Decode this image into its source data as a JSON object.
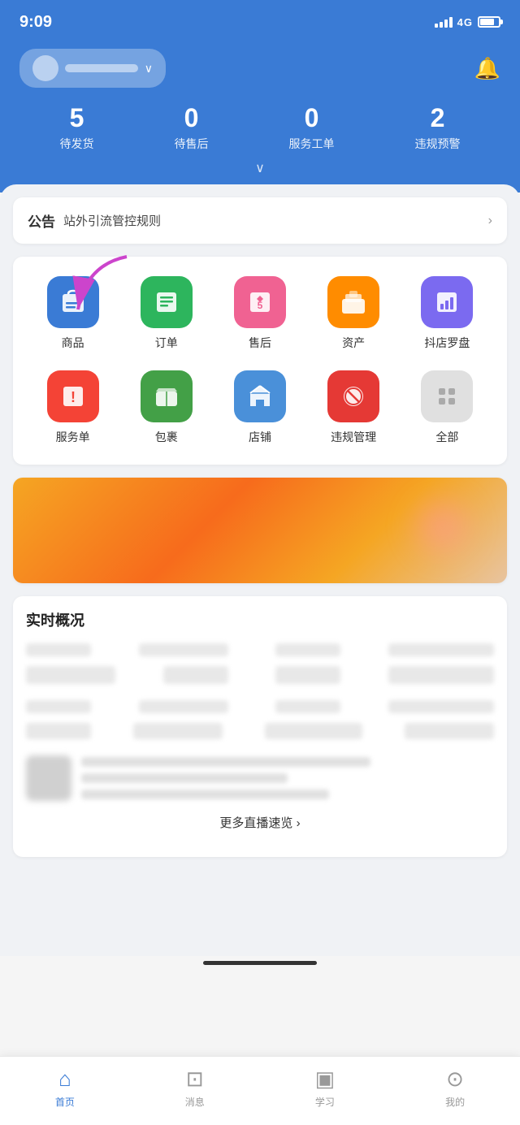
{
  "statusBar": {
    "time": "9:09",
    "network": "4G"
  },
  "header": {
    "storeName": "",
    "bellLabel": "通知",
    "stats": [
      {
        "key": "pending_ship",
        "number": "5",
        "label": "待发货"
      },
      {
        "key": "pending_after",
        "number": "0",
        "label": "待售后"
      },
      {
        "key": "service_order",
        "number": "0",
        "label": "服务工单"
      },
      {
        "key": "violation",
        "number": "2",
        "label": "违规预警"
      }
    ],
    "expandLabel": "∨"
  },
  "announcement": {
    "tag": "公告",
    "text": "站外引流管控规则",
    "arrow": ">"
  },
  "menuGrid": {
    "rows": [
      [
        {
          "id": "goods",
          "label": "商品",
          "iconColor": "blue",
          "iconType": "bag"
        },
        {
          "id": "orders",
          "label": "订单",
          "iconColor": "green",
          "iconType": "list"
        },
        {
          "id": "aftersale",
          "label": "售后",
          "iconColor": "pink",
          "iconType": "return"
        },
        {
          "id": "assets",
          "label": "资产",
          "iconColor": "orange",
          "iconType": "folder"
        },
        {
          "id": "compass",
          "label": "抖店罗盘",
          "iconColor": "purple",
          "iconType": "chart"
        }
      ],
      [
        {
          "id": "service",
          "label": "服务单",
          "iconColor": "red",
          "iconType": "exclaim"
        },
        {
          "id": "package",
          "label": "包裹",
          "iconColor": "green2",
          "iconType": "box"
        },
        {
          "id": "shop",
          "label": "店铺",
          "iconColor": "blue2",
          "iconType": "store"
        },
        {
          "id": "violation",
          "label": "违规管理",
          "iconColor": "redgray",
          "iconType": "ban"
        },
        {
          "id": "all",
          "label": "全部",
          "iconColor": "gray",
          "iconType": "grid"
        }
      ]
    ]
  },
  "realtimeSection": {
    "title": "实时概况",
    "moreText": "更多直播速览",
    "moreArrow": ">"
  },
  "bottomNav": {
    "items": [
      {
        "id": "home",
        "label": "首页",
        "active": true
      },
      {
        "id": "message",
        "label": "消息",
        "active": false
      },
      {
        "id": "learn",
        "label": "学习",
        "active": false
      },
      {
        "id": "mine",
        "label": "我的",
        "active": false
      }
    ]
  }
}
